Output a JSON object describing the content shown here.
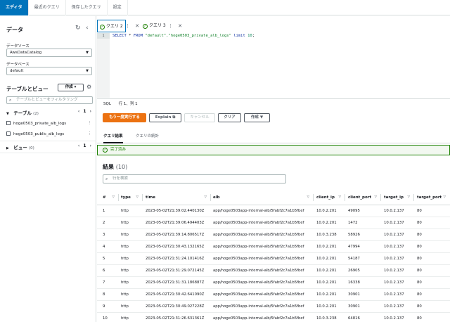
{
  "top_tabs": [
    "エディタ",
    "最近のクエリ",
    "保存したクエリ",
    "設定"
  ],
  "sidebar": {
    "title": "データ",
    "datasource_label": "データソース",
    "datasource_value": "AwsDataCatalog",
    "database_label": "データベース",
    "database_value": "default",
    "tables_views_title": "テーブルとビュー",
    "create_label": "作成",
    "filter_placeholder": "テーブルとビューをフィルタリング",
    "tables_label": "テーブル",
    "tables_count": "(2)",
    "tables_page": "1",
    "tables": [
      "hoge0503_private_alb_logs",
      "hoge0503_public_alb_logs"
    ],
    "views_label": "ビュー",
    "views_count": "(0)",
    "views_page": "1"
  },
  "editor": {
    "tabs": [
      {
        "label": "クエリ 2"
      },
      {
        "label": "クエリ 3"
      }
    ],
    "line_number": "1",
    "code": {
      "kw1": "SELECT",
      "mid1": " * ",
      "kw2": "FROM",
      "str": " \"default\".\"hoge0503_private_alb_logs\" ",
      "kw3": "limit",
      "num": " 10",
      "end": ";"
    },
    "status": {
      "language": "SQL",
      "position": "行 1、列 1"
    }
  },
  "buttons": {
    "run_again": "もう一度実行する",
    "explain": "Explain",
    "cancel": "キャンセル",
    "clear": "クリア",
    "create": "作成"
  },
  "result_tabs": [
    "クエリ結果",
    "クエリの統計"
  ],
  "banner": "完了済み",
  "results": {
    "title": "結果",
    "count": "(10)",
    "search_placeholder": "行を検索"
  },
  "table": {
    "columns": [
      "#",
      "type",
      "time",
      "elb",
      "client_ip",
      "client_port",
      "target_ip",
      "target_port"
    ],
    "rows": [
      [
        "1",
        "http",
        "2023-05-02T21:39:02.440130Z",
        "app/hoge0503app-internal-alb/5fabf2c7a1b5fbef",
        "10.0.2.201",
        "49095",
        "10.0.2.137",
        "80"
      ],
      [
        "2",
        "http",
        "2023-05-02T21:39:06.494403Z",
        "app/hoge0503app-internal-alb/5fabf2c7a1b5fbef",
        "10.0.2.201",
        "1472",
        "10.0.2.137",
        "80"
      ],
      [
        "3",
        "http",
        "2023-05-02T21:39:14.806517Z",
        "app/hoge0503app-internal-alb/5fabf2c7a1b5fbef",
        "10.0.3.238",
        "58926",
        "10.0.2.137",
        "80"
      ],
      [
        "4",
        "http",
        "2023-05-02T21:30:43.132165Z",
        "app/hoge0503app-internal-alb/5fabf2c7a1b5fbef",
        "10.0.2.201",
        "47994",
        "10.0.2.137",
        "80"
      ],
      [
        "5",
        "http",
        "2023-05-02T21:31:24.101416Z",
        "app/hoge0503app-internal-alb/5fabf2c7a1b5fbef",
        "10.0.2.201",
        "54187",
        "10.0.2.137",
        "80"
      ],
      [
        "6",
        "http",
        "2023-05-02T21:31:29.072145Z",
        "app/hoge0503app-internal-alb/5fabf2c7a1b5fbef",
        "10.0.2.201",
        "26905",
        "10.0.2.137",
        "80"
      ],
      [
        "7",
        "http",
        "2023-05-02T21:31:31.186887Z",
        "app/hoge0503app-internal-alb/5fabf2c7a1b5fbef",
        "10.0.2.201",
        "16338",
        "10.0.2.137",
        "80"
      ],
      [
        "8",
        "http",
        "2023-05-02T21:30:42.641090Z",
        "app/hoge0503app-internal-alb/5fabf2c7a1b5fbef",
        "10.0.2.201",
        "30901",
        "10.0.2.137",
        "80"
      ],
      [
        "9",
        "http",
        "2023-05-02T21:30:49.027228Z",
        "app/hoge0503app-internal-alb/5fabf2c7a1b5fbef",
        "10.0.2.201",
        "30901",
        "10.0.2.137",
        "80"
      ],
      [
        "10",
        "http",
        "2023-05-02T21:31:26.631361Z",
        "app/hoge0503app-internal-alb/5fabf2c7a1b5fbef",
        "10.0.3.238",
        "64816",
        "10.0.2.137",
        "80"
      ]
    ]
  }
}
